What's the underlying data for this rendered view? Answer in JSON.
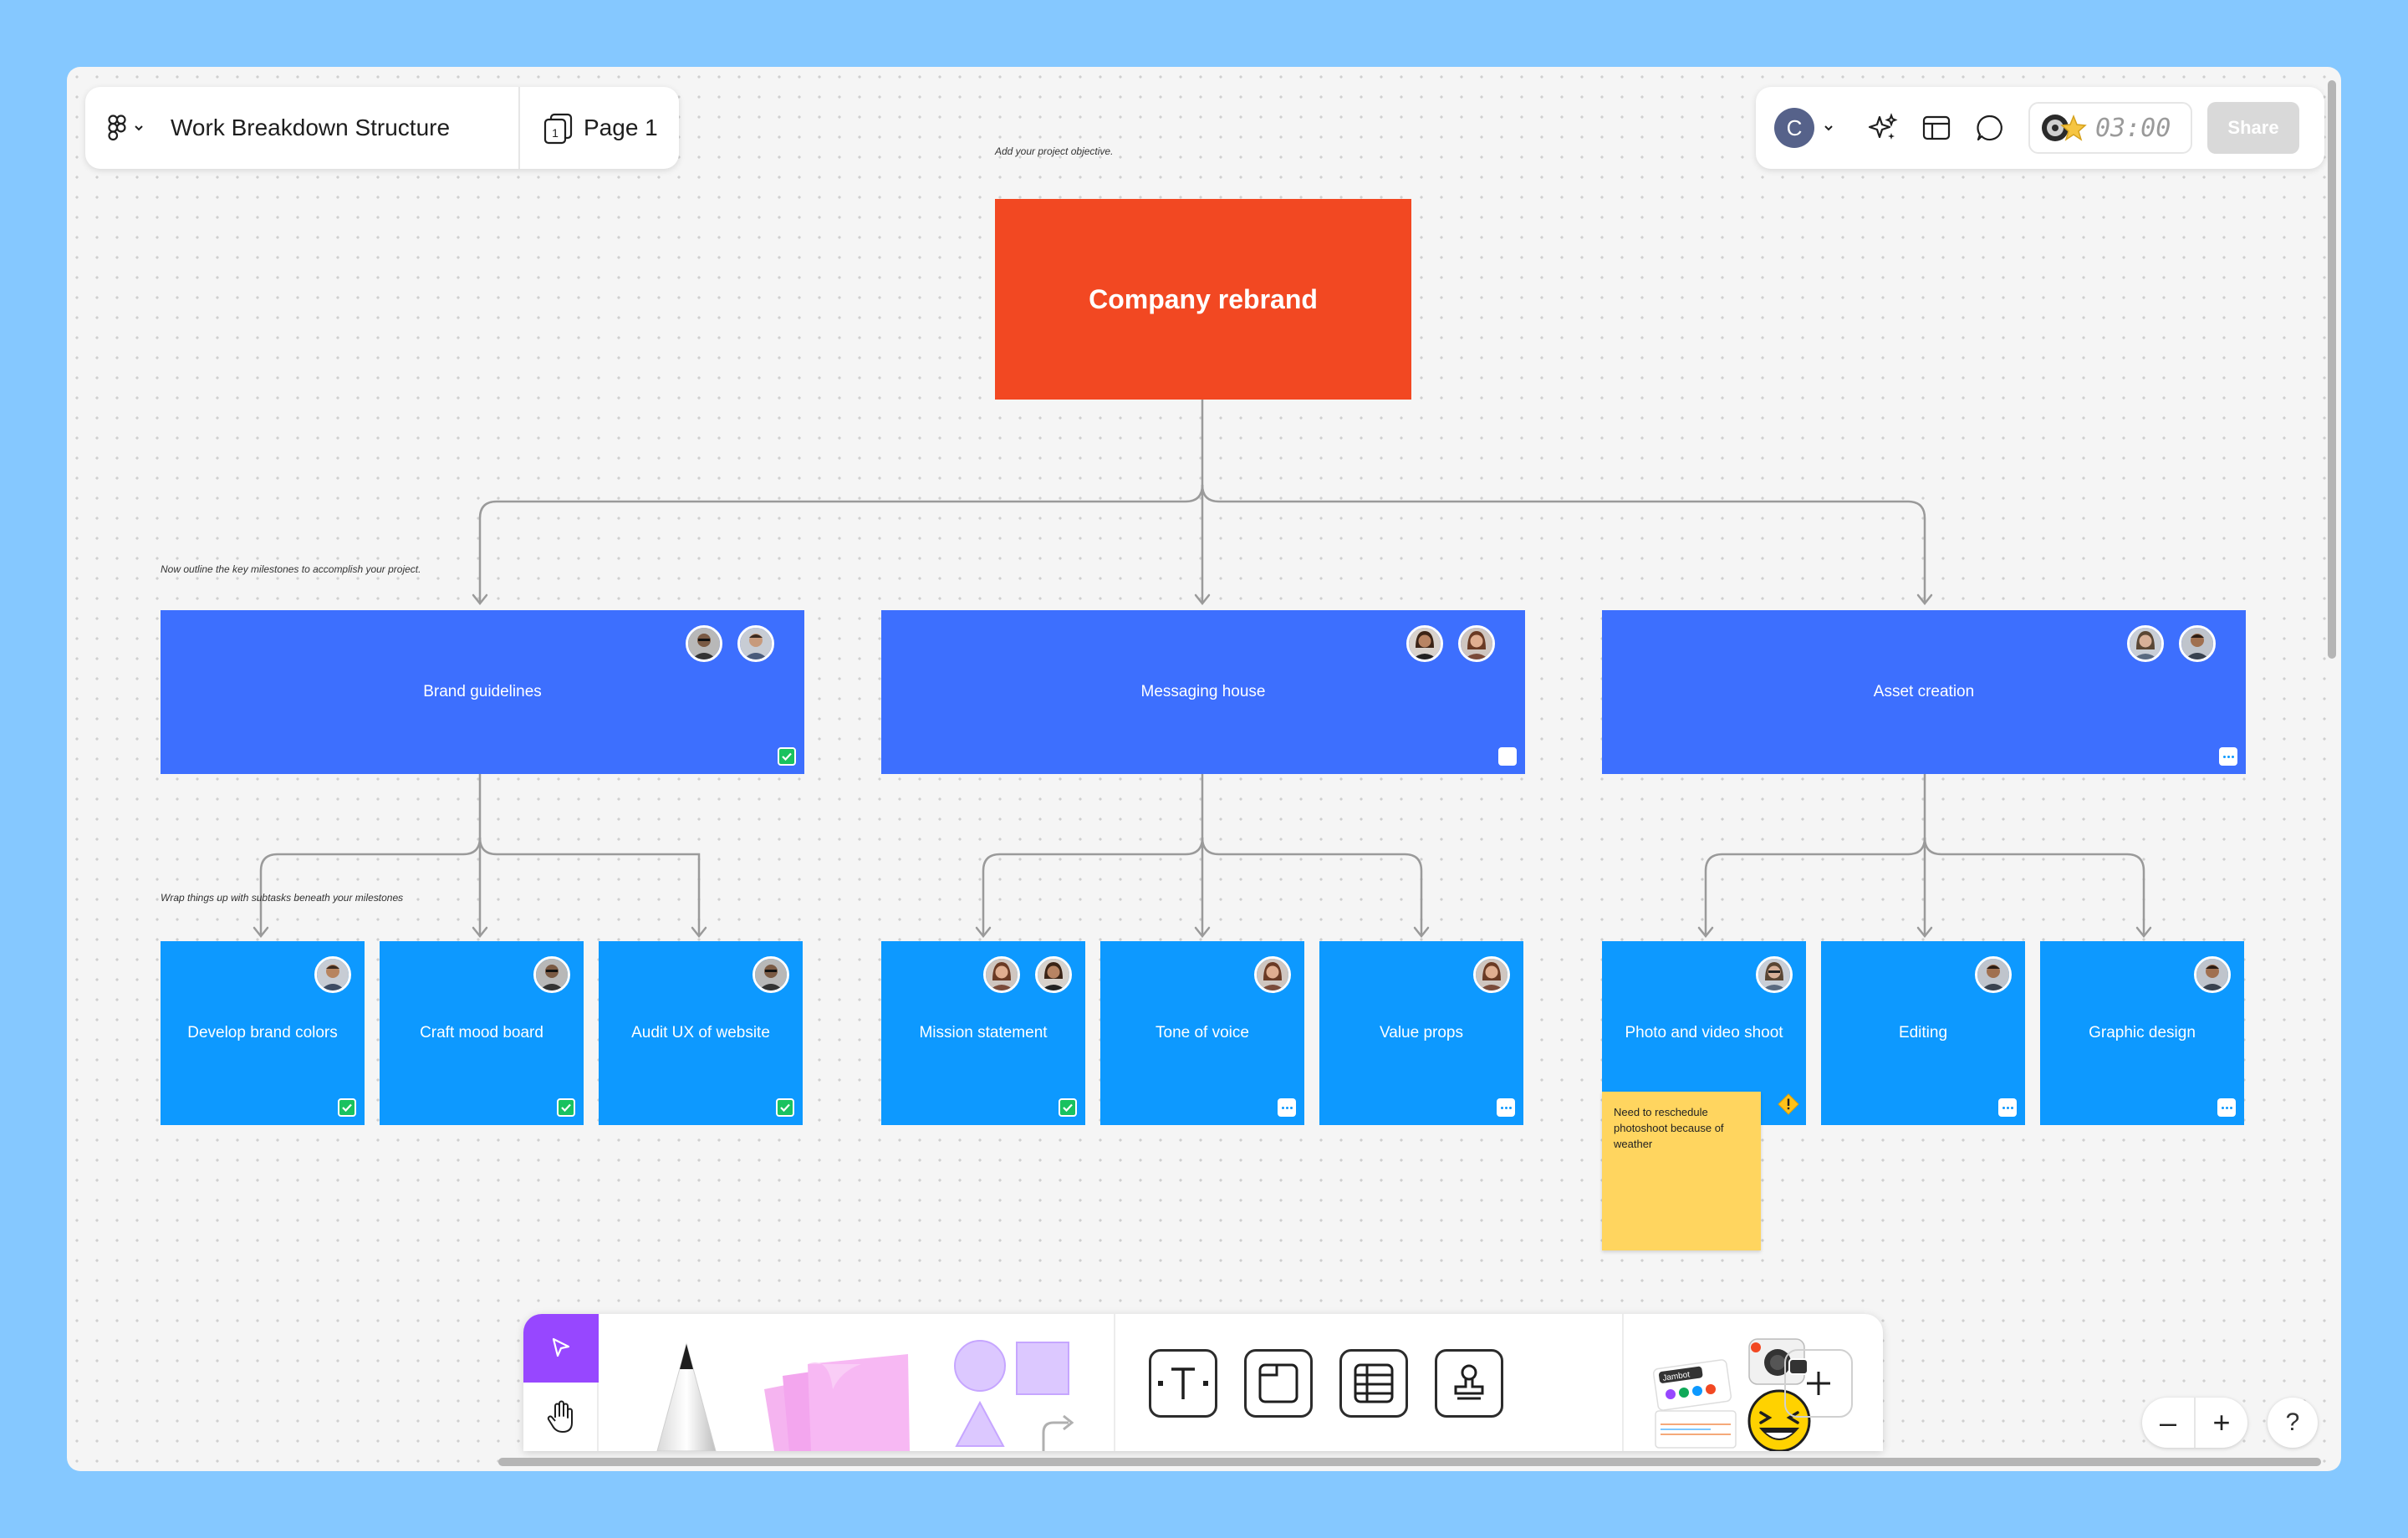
{
  "file": {
    "title": "Work Breakdown Structure",
    "page": "Page 1",
    "page_number": "1"
  },
  "toolbar_right": {
    "user_initial": "C",
    "timer": "03:00",
    "share_label": "Share"
  },
  "hints": {
    "objective": "Add your project objective.",
    "milestones": "Now outline the key milestones to accomplish your project.",
    "subtasks": "Wrap things up with subtasks beneath your milestones"
  },
  "root": {
    "label": "Company rebrand",
    "color": "#f24822"
  },
  "milestones": [
    {
      "label": "Brand guidelines",
      "status": "done"
    },
    {
      "label": "Messaging house",
      "status": "empty"
    },
    {
      "label": "Asset creation",
      "status": "more"
    }
  ],
  "tasks": [
    {
      "label": "Develop brand colors",
      "status": "done"
    },
    {
      "label": "Craft mood board",
      "status": "done"
    },
    {
      "label": "Audit UX of website",
      "status": "done"
    },
    {
      "label": "Mission statement",
      "status": "done"
    },
    {
      "label": "Tone of voice",
      "status": "more"
    },
    {
      "label": "Value props",
      "status": "more"
    },
    {
      "label": "Photo and video shoot",
      "status": "warning"
    },
    {
      "label": "Editing",
      "status": "more"
    },
    {
      "label": "Graphic design",
      "status": "more"
    }
  ],
  "sticky_note": {
    "text": "Need to reschedule photoshoot because of weather",
    "color": "#ffd55f"
  },
  "colors": {
    "milestone": "#3d6ffe",
    "task": "#0d99ff",
    "accent": "#9747ff",
    "check": "#19c25f"
  },
  "stickers_label": "Jambot",
  "zoom": {
    "minus": "–",
    "plus": "+",
    "help": "?"
  }
}
